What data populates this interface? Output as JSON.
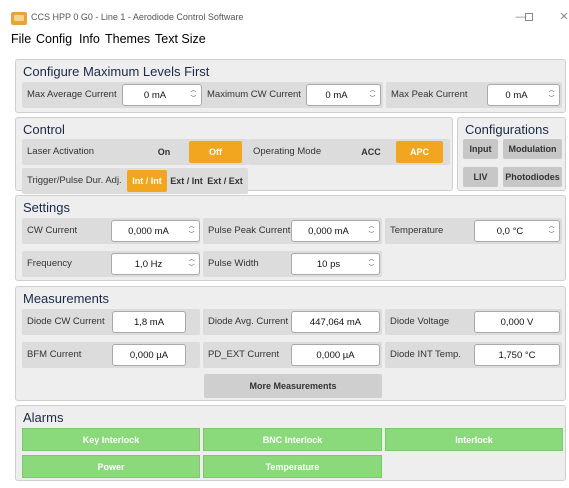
{
  "window": {
    "title": "CCS HPP 0 G0 - Line 1 - Aerodiode Control Software",
    "icon": "app-icon",
    "controls": [
      "minimize-icon",
      "maximize-icon",
      "close-icon"
    ]
  },
  "menu": [
    "File",
    "Config",
    "Info",
    "Themes",
    "Text Size"
  ],
  "max_levels": {
    "title": "Configure Maximum Levels First",
    "avg": {
      "label": "Max Average Current",
      "value": "0 mA"
    },
    "cw": {
      "label": "Maximum CW Current",
      "value": "0 mA"
    },
    "peak": {
      "label": "Max Peak Current",
      "value": "0 mA"
    }
  },
  "control": {
    "title": "Control",
    "laser_label": "Laser Activation",
    "laser_on": "On",
    "laser_off": "Off",
    "laser_selected": "Off",
    "mode_label": "Operating Mode",
    "mode_acc": "ACC",
    "mode_apc": "APC",
    "mode_selected": "APC",
    "trigger_label": "Trigger/Pulse Dur. Adj.",
    "trigger_options": [
      "Int / Int",
      "Ext / Int",
      "Ext / Ext"
    ],
    "trigger_selected": "Int / Int"
  },
  "configurations": {
    "title": "Configurations",
    "input": "Input",
    "modulation": "Modulation",
    "liv": "LIV",
    "photodiodes": "Photodiodes"
  },
  "settings": {
    "title": "Settings",
    "cw_current": {
      "label": "CW Current",
      "value": "0,000 mA"
    },
    "pulse_peak": {
      "label": "Pulse Peak Current",
      "value": "0,000 mA"
    },
    "temperature": {
      "label": "Temperature",
      "value": "0,0 °C"
    },
    "frequency": {
      "label": "Frequency",
      "value": "1,0 Hz"
    },
    "pulse_width": {
      "label": "Pulse Width",
      "value": "10 ps"
    }
  },
  "measurements": {
    "title": "Measurements",
    "diode_cw": {
      "label": "Diode CW Current",
      "value": "1,8 mA"
    },
    "diode_avg": {
      "label": "Diode Avg. Current",
      "value": "447,064 mA"
    },
    "diode_voltage": {
      "label": "Diode Voltage",
      "value": "0,000 V"
    },
    "bfm": {
      "label": "BFM Current",
      "value": "0,000 µA"
    },
    "pd_ext": {
      "label": "PD_EXT Current",
      "value": "0,000 µA"
    },
    "diode_temp": {
      "label": "Diode INT Temp.",
      "value": "1,750 °C"
    },
    "more": "More Measurements"
  },
  "alarms": {
    "title": "Alarms",
    "key_interlock": "Key Interlock",
    "bnc_interlock": "BNC Interlock",
    "interlock": "Interlock",
    "power": "Power",
    "temperature": "Temperature"
  },
  "colors": {
    "accent_orange": "#f2a61f",
    "alarm_green": "#8ad97a",
    "panel_bg": "#eeeeee",
    "title_navy": "#1a2a48"
  }
}
